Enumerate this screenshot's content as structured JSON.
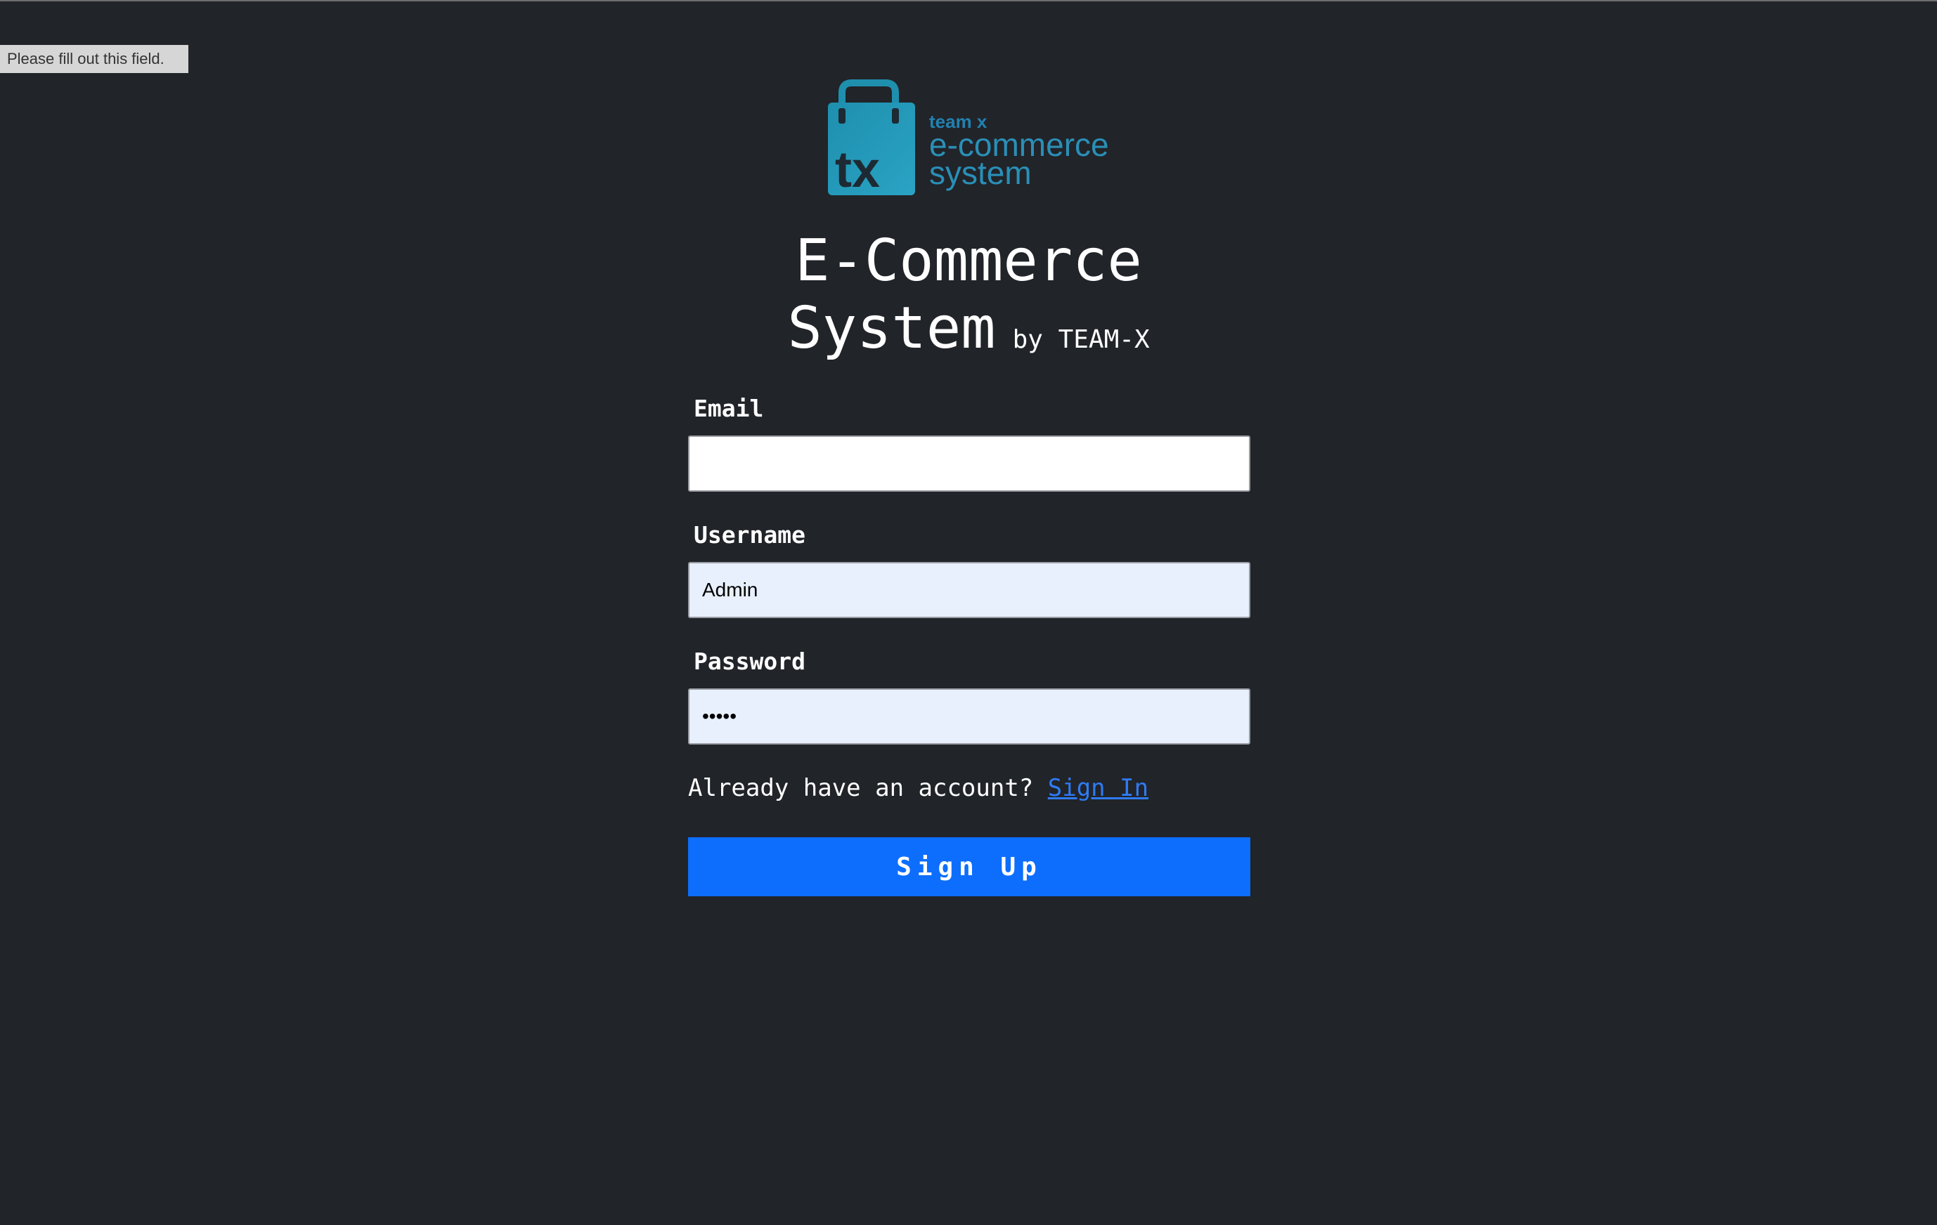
{
  "tooltip": {
    "text": "Please fill out this field."
  },
  "logo": {
    "badge_text": "tx",
    "line1": "team x",
    "line2": "e-commerce",
    "line3": "system",
    "color": "#2a8fb7",
    "icon": "shopping-bag-icon"
  },
  "header": {
    "title_line1": "E-Commerce",
    "title_line2": "System",
    "byline": "by TEAM-X"
  },
  "form": {
    "email": {
      "label": "Email",
      "value": ""
    },
    "username": {
      "label": "Username",
      "value": "Admin"
    },
    "password": {
      "label": "Password",
      "value": "•••••"
    },
    "account_prompt": "Already have an account?",
    "signin_link": "Sign In",
    "submit_label": "Sign Up"
  },
  "colors": {
    "background": "#212429",
    "primary": "#0d6efd",
    "link": "#2f7bf5",
    "autofill": "#e8f0fe"
  }
}
